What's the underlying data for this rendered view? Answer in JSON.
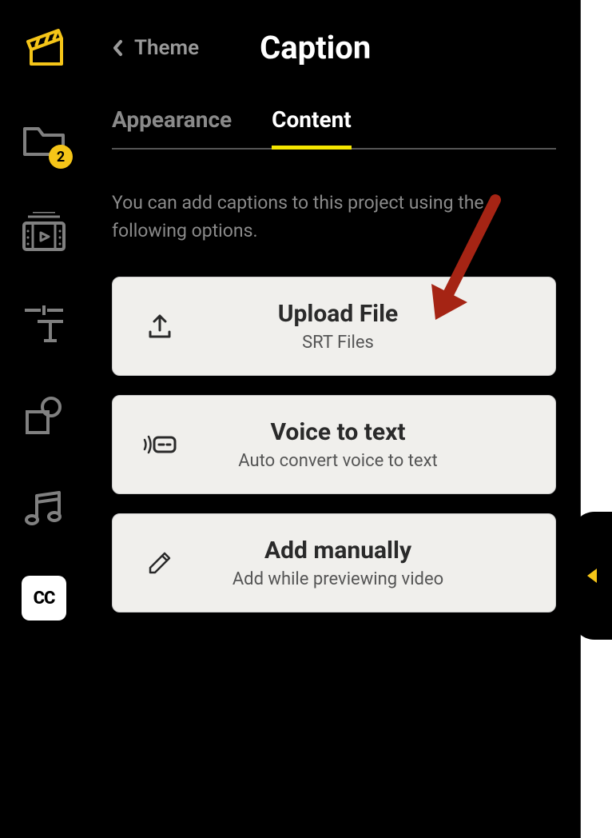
{
  "header": {
    "back_label": "Theme",
    "title": "Caption"
  },
  "tabs": {
    "appearance": "Appearance",
    "content": "Content"
  },
  "description": "You can add captions to this project using the following options.",
  "options": {
    "upload": {
      "title": "Upload File",
      "subtitle": "SRT Files"
    },
    "voice": {
      "title": "Voice to text",
      "subtitle": "Auto convert voice to text"
    },
    "manual": {
      "title": "Add manually",
      "subtitle": "Add while previewing video"
    }
  },
  "sidebar": {
    "badge_count": "2"
  }
}
